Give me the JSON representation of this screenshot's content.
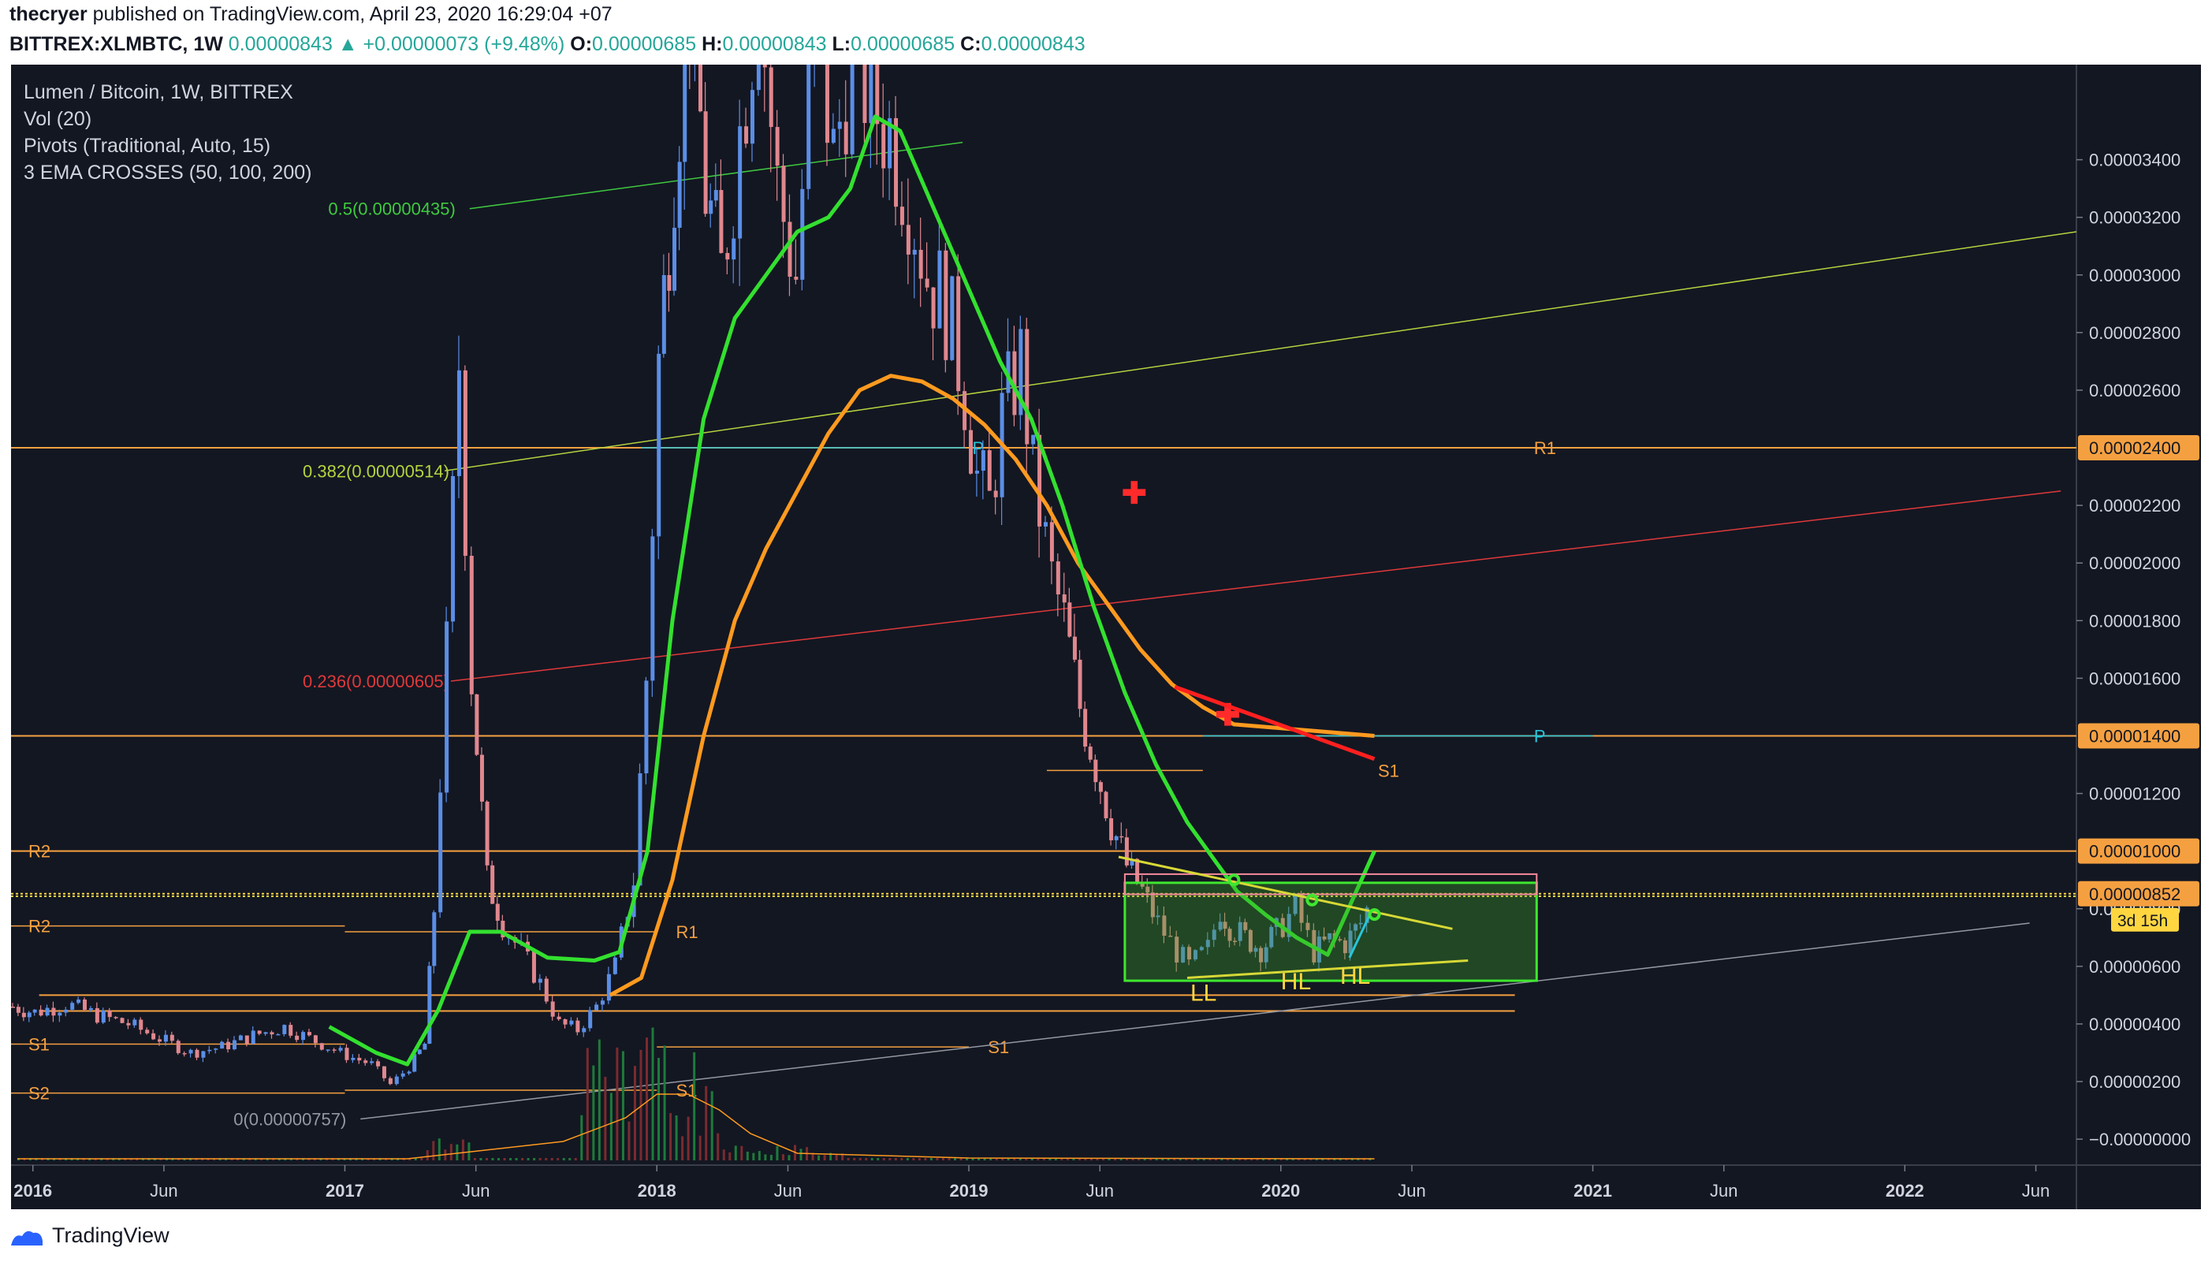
{
  "header": {
    "author": "thecryer",
    "published": "published on TradingView.com, April 23, 2020 16:29:04 +07",
    "symbol": "BITTREX:XLMBTC, 1W",
    "last": "0.00000843",
    "change": "+0.00000073 (+9.48%)",
    "o_label": "O:",
    "o": "0.00000685",
    "h_label": "H:",
    "h": "0.00000843",
    "l_label": "L:",
    "l": "0.00000685",
    "c_label": "C:",
    "c": "0.00000843"
  },
  "legend": [
    "Lumen / Bitcoin, 1W, BITTREX",
    "Vol (20)",
    "Pivots (Traditional, Auto, 15)",
    "3 EMA CROSSES (50, 100, 200)"
  ],
  "footer": {
    "brand": "TradingView"
  },
  "colors": {
    "background": "#131722",
    "up": "#5b8ee6",
    "down": "#e0878e",
    "ema_fast": "#33e02f",
    "ema_slow": "#ff9a1f",
    "pivot": "#f5a040",
    "fib_05": "#3fc93f",
    "fib_0382": "#b6d33e",
    "fib_0236": "#e0393a",
    "fib_0": "#9598a1"
  },
  "chart_data": {
    "type": "candlestick",
    "y_axis": {
      "min": 0.0,
      "max": 3.6e-05,
      "ticks": [
        "0.00003400",
        "0.00003200",
        "0.00003000",
        "0.00002800",
        "0.00002600",
        "0.00002200",
        "0.00002000",
        "0.00001800",
        "0.00001600",
        "0.00001200",
        "0.00000800",
        "0.00000600",
        "0.00000400",
        "0.00000200",
        "−0.00000000"
      ],
      "tick_values": [
        34,
        32,
        30,
        28,
        26,
        22,
        20,
        18,
        16,
        12,
        8,
        6,
        4,
        2,
        0
      ],
      "highlight_labels": [
        {
          "text": "0.00002400",
          "value": 24,
          "color": "#f5a040"
        },
        {
          "text": "0.00001400",
          "value": 14,
          "color": "#f5a040"
        },
        {
          "text": "0.00001000",
          "value": 10,
          "color": "#f5a040"
        },
        {
          "text": "0.00000852",
          "value": 8.52,
          "color": "#f5a040"
        }
      ],
      "countdown": "3d 15h",
      "unit_scale": "values in 1e-6 BTC"
    },
    "x_axis": {
      "labels": [
        "2016",
        "Jun",
        "2017",
        "Jun",
        "2018",
        "Jun",
        "2019",
        "Jun",
        "2020",
        "Jun",
        "2021",
        "Jun",
        "2022",
        "Jun"
      ],
      "label_dates": [
        2016.0,
        2016.42,
        2017.0,
        2017.42,
        2018.0,
        2018.42,
        2019.0,
        2019.42,
        2020.0,
        2020.42,
        2021.0,
        2021.42,
        2022.0,
        2022.42
      ],
      "bold": [
        "2016",
        "2017",
        "2018",
        "2019",
        "2020",
        "2021",
        "2022"
      ],
      "min": 2015.93,
      "max": 2022.55
    },
    "candles_anchor": [
      [
        2015.93,
        4.6
      ],
      [
        2016.0,
        4.4
      ],
      [
        2016.1,
        4.7
      ],
      [
        2016.2,
        4.3
      ],
      [
        2016.3,
        4.0
      ],
      [
        2016.4,
        3.5
      ],
      [
        2016.5,
        3.0
      ],
      [
        2016.6,
        3.2
      ],
      [
        2016.7,
        3.6
      ],
      [
        2016.8,
        3.9
      ],
      [
        2016.9,
        3.4
      ],
      [
        2017.0,
        2.9
      ],
      [
        2017.08,
        2.6
      ],
      [
        2017.14,
        1.9
      ],
      [
        2017.2,
        2.5
      ],
      [
        2017.25,
        3.3
      ],
      [
        2017.28,
        8.0
      ],
      [
        2017.32,
        17.0
      ],
      [
        2017.36,
        27.0
      ],
      [
        2017.4,
        16.0
      ],
      [
        2017.45,
        9.0
      ],
      [
        2017.5,
        7.5
      ],
      [
        2017.56,
        6.5
      ],
      [
        2017.62,
        5.4
      ],
      [
        2017.68,
        4.0
      ],
      [
        2017.74,
        3.8
      ],
      [
        2017.8,
        4.6
      ],
      [
        2017.86,
        6.0
      ],
      [
        2017.92,
        9.0
      ],
      [
        2017.96,
        16.0
      ],
      [
        2018.0,
        27.0
      ],
      [
        2018.05,
        34.0
      ],
      [
        2018.1,
        40.0
      ],
      [
        2018.15,
        33.0
      ],
      [
        2018.2,
        30.0
      ],
      [
        2018.26,
        35.0
      ],
      [
        2018.32,
        40.0
      ],
      [
        2018.38,
        33.0
      ],
      [
        2018.44,
        30.0
      ],
      [
        2018.5,
        39.0
      ],
      [
        2018.56,
        34.0
      ],
      [
        2018.62,
        38.0
      ],
      [
        2018.68,
        36.0
      ],
      [
        2018.74,
        35.0
      ],
      [
        2018.8,
        33.0
      ],
      [
        2018.86,
        30.0
      ],
      [
        2018.92,
        29.0
      ],
      [
        2018.98,
        26.0
      ],
      [
        2019.02,
        23.0
      ],
      [
        2019.06,
        22.0
      ],
      [
        2019.1,
        25.0
      ],
      [
        2019.16,
        27.0
      ],
      [
        2019.2,
        23.0
      ],
      [
        2019.26,
        19.5
      ],
      [
        2019.3,
        18.0
      ],
      [
        2019.35,
        15.0
      ],
      [
        2019.4,
        13.0
      ],
      [
        2019.45,
        11.0
      ],
      [
        2019.5,
        9.5
      ],
      [
        2019.55,
        8.6
      ],
      [
        2019.6,
        7.5
      ],
      [
        2019.66,
        6.5
      ],
      [
        2019.7,
        6.0
      ],
      [
        2019.76,
        6.6
      ],
      [
        2019.8,
        8.0
      ],
      [
        2019.83,
        7.4
      ],
      [
        2019.88,
        7.0
      ],
      [
        2019.93,
        6.6
      ],
      [
        2019.98,
        7.2
      ],
      [
        2020.04,
        8.0
      ],
      [
        2020.1,
        6.5
      ],
      [
        2020.15,
        6.9
      ],
      [
        2020.2,
        6.8
      ],
      [
        2020.25,
        7.5
      ],
      [
        2020.29,
        8.43
      ]
    ],
    "ema_fast_anchor": [
      [
        2016.95,
        3.9
      ],
      [
        2017.1,
        3.0
      ],
      [
        2017.2,
        2.6
      ],
      [
        2017.3,
        4.5
      ],
      [
        2017.4,
        7.2
      ],
      [
        2017.5,
        7.2
      ],
      [
        2017.65,
        6.3
      ],
      [
        2017.8,
        6.2
      ],
      [
        2017.88,
        6.5
      ],
      [
        2017.97,
        10.0
      ],
      [
        2018.05,
        18.0
      ],
      [
        2018.15,
        25.0
      ],
      [
        2018.25,
        28.5
      ],
      [
        2018.35,
        30.0
      ],
      [
        2018.45,
        31.5
      ],
      [
        2018.55,
        32.0
      ],
      [
        2018.62,
        33.0
      ],
      [
        2018.7,
        35.5
      ],
      [
        2018.78,
        35.0
      ],
      [
        2018.9,
        32.0
      ],
      [
        2019.0,
        29.5
      ],
      [
        2019.1,
        27.0
      ],
      [
        2019.2,
        25.0
      ],
      [
        2019.3,
        22.0
      ],
      [
        2019.4,
        18.5
      ],
      [
        2019.5,
        15.5
      ],
      [
        2019.6,
        13.0
      ],
      [
        2019.7,
        11.0
      ],
      [
        2019.8,
        9.5
      ],
      [
        2019.86,
        8.6
      ],
      [
        2019.95,
        7.8
      ],
      [
        2020.05,
        7.0
      ],
      [
        2020.15,
        6.4
      ],
      [
        2020.3,
        10.0
      ]
    ],
    "ema_slow_anchor": [
      [
        2017.85,
        5.0
      ],
      [
        2017.95,
        5.6
      ],
      [
        2018.05,
        9.0
      ],
      [
        2018.15,
        14.0
      ],
      [
        2018.25,
        18.0
      ],
      [
        2018.35,
        20.5
      ],
      [
        2018.45,
        22.5
      ],
      [
        2018.55,
        24.5
      ],
      [
        2018.65,
        26.0
      ],
      [
        2018.75,
        26.5
      ],
      [
        2018.85,
        26.3
      ],
      [
        2018.95,
        25.7
      ],
      [
        2019.05,
        24.8
      ],
      [
        2019.15,
        23.6
      ],
      [
        2019.25,
        22.0
      ],
      [
        2019.35,
        20.0
      ],
      [
        2019.45,
        18.5
      ],
      [
        2019.55,
        17.0
      ],
      [
        2019.65,
        15.8
      ],
      [
        2019.75,
        15.0
      ],
      [
        2019.85,
        14.4
      ],
      [
        2020.3,
        14.0
      ]
    ],
    "pivot_levels": [
      {
        "name": "R1",
        "value": 24.0,
        "x0": 2019.75,
        "x1": 2021.0
      },
      {
        "name": "P",
        "value": 14.0,
        "x0": 2019.75,
        "x1": 2021.0
      },
      {
        "name": "S1",
        "value": 12.8,
        "x0": 2019.25,
        "x1": 2019.75
      },
      {
        "name": "R2",
        "value": 10.0,
        "x0": 2015.93,
        "x1": 2021.0
      },
      {
        "name": "R1",
        "value": 7.2,
        "x0": 2017.0,
        "x1": 2018.0
      },
      {
        "name": "P",
        "value": 24.0,
        "x0": 2017.95,
        "x1": 2018.99
      },
      {
        "name": "R2",
        "value": 7.4,
        "x0": 2015.93,
        "x1": 2017.0
      },
      {
        "name": "S1",
        "value": 3.2,
        "x0": 2018.0,
        "x1": 2019.0
      },
      {
        "name": "S1",
        "value": 1.7,
        "x0": 2017.0,
        "x1": 2018.0
      },
      {
        "name": "S1",
        "value": 3.3,
        "x0": 2015.93,
        "x1": 2017.0
      },
      {
        "name": "S2",
        "value": 1.6,
        "x0": 2015.93,
        "x1": 2017.0
      }
    ],
    "fib_levels": [
      {
        "label": "0.5(0.00000435)",
        "color": "#3fc93f"
      },
      {
        "label": "0.382(0.00000514)",
        "color": "#b6d33e"
      },
      {
        "label": "0.236(0.00000605)",
        "color": "#e0393a"
      },
      {
        "label": "0(0.00000757)",
        "color": "#9598a1"
      }
    ],
    "annotations": [
      "LL",
      "HL",
      "HL"
    ]
  }
}
